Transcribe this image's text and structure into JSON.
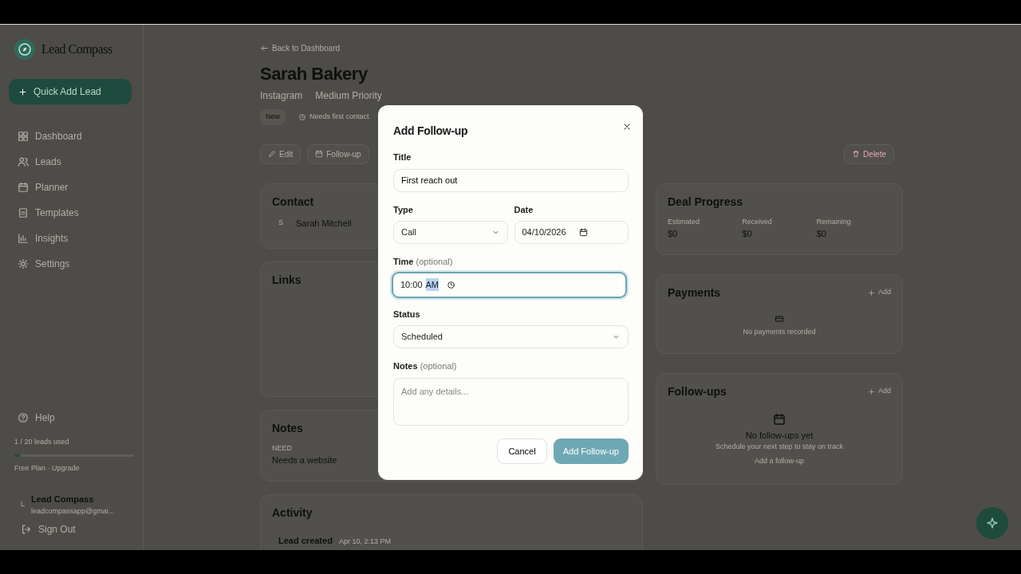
{
  "sidebar": {
    "brand": "Lead Compass",
    "quick_add": "Quick Add Lead",
    "items": [
      {
        "label": "Dashboard",
        "selected": false
      },
      {
        "label": "Leads",
        "selected": false
      },
      {
        "label": "Planner",
        "selected": false
      },
      {
        "label": "Templates",
        "selected": false
      },
      {
        "label": "Insights",
        "selected": false
      },
      {
        "label": "Settings",
        "selected": false
      }
    ],
    "help": "Help",
    "usage": "1 / 20 leads used",
    "usage_bar": {
      "level": 0.05
    },
    "plan": "Free Plan · Upgrade",
    "account": {
      "initial": "L",
      "name": "Lead Compass",
      "email": "leadcompassapp@gmai..."
    },
    "sign_out": "Sign Out"
  },
  "lead": {
    "back": "Back to Dashboard",
    "name": "Sarah Bakery",
    "source": "Instagram",
    "priority": "Medium Priority",
    "stage": "New",
    "hint": "Needs first contact",
    "actions": [
      {
        "label": "Edit",
        "kind": "edit"
      },
      {
        "label": "Follow-up",
        "kind": "followup"
      },
      {
        "label": "Delete",
        "kind": "delete"
      }
    ]
  },
  "contact": {
    "title": "Contact",
    "initial": "S",
    "name": "Sarah Mitchell"
  },
  "links": {
    "title": "Links"
  },
  "notes": {
    "title": "Notes",
    "label": "NEED",
    "text": "Needs a website"
  },
  "activity": {
    "title": "Activity",
    "items": [
      {
        "title": "Lead created",
        "time": "Apr 10, 2:13 PM"
      }
    ]
  },
  "deal": {
    "title": "Deal Progress",
    "stats": [
      {
        "label": "Estimated",
        "value": "$0"
      },
      {
        "label": "Received",
        "value": "$0"
      },
      {
        "label": "Remaining",
        "value": "$0"
      }
    ]
  },
  "payments": {
    "title": "Payments",
    "add": "Add",
    "empty": "No payments recorded"
  },
  "followups": {
    "title": "Follow-ups",
    "add": "Add",
    "empty_title": "No follow-ups yet",
    "empty_text": "Schedule your next step to stay on track",
    "empty_link": "Add a follow-up"
  },
  "modal": {
    "title": "Add Follow-up",
    "title_label": "Title",
    "title_value": "First reach out",
    "type_label": "Type",
    "type_value": "Call",
    "date_label": "Date",
    "date_value": "04/10/2026",
    "time_label": "Time",
    "time_hint": "(optional)",
    "time_value": "10:00",
    "time_period": "AM",
    "time_focused": true,
    "period_highlighted": true,
    "status_label": "Status",
    "status_value": "Scheduled",
    "notes_label": "Notes",
    "notes_hint": "(optional)",
    "notes_placeholder": "Add any details...",
    "cancel": "Cancel",
    "submit": "Add Follow-up"
  }
}
